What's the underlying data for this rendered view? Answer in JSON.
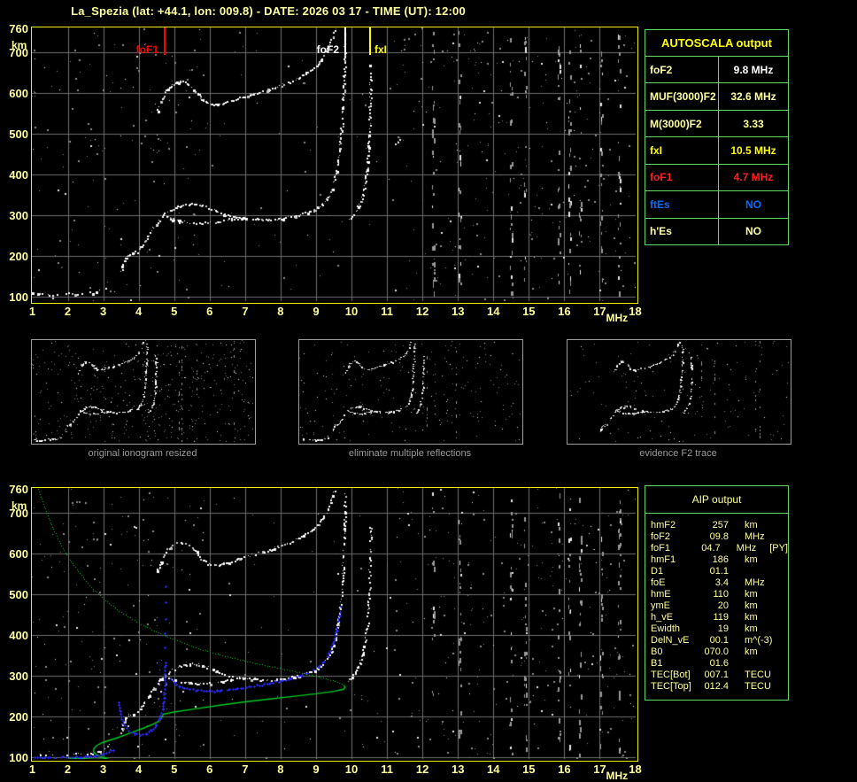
{
  "title": "La_Spezia (lat: +44.1, lon: 009.8) - DATE: 2026 03 17 - TIME (UT): 12:00",
  "colors": {
    "pale_yellow": "#ffff9b",
    "bright_yellow": "#ffff00",
    "white": "#ffffff",
    "red": "#ff1e1e",
    "blue": "#0a6bff",
    "trace_blue": "#2a2af0",
    "profile_green": "#00cc22",
    "table_green": "#62d862",
    "grid_gray": "#6f6f6f",
    "plot_border": "#eded10",
    "caption_gray": "#9a9a9a"
  },
  "autoscala_table": {
    "title": "AUTOSCALA output",
    "rows": [
      {
        "label": "foF2",
        "value": "9.8 MHz",
        "labelColor": "#ffff9b",
        "valueColor": "#ffffff"
      },
      {
        "label": "MUF(3000)F2",
        "value": "32.6 MHz",
        "labelColor": "#ffff9b",
        "valueColor": "#ffff9b"
      },
      {
        "label": "M(3000)F2",
        "value": "3.33",
        "labelColor": "#ffff9b",
        "valueColor": "#ffff9b"
      },
      {
        "label": "fxI",
        "value": "10.5 MHz",
        "labelColor": "#ffff00",
        "valueColor": "#ffff00"
      },
      {
        "label": "foF1",
        "value": "4.7 MHz",
        "labelColor": "#ff1e1e",
        "valueColor": "#ff1e1e"
      },
      {
        "label": "ftEs",
        "value": "NO",
        "labelColor": "#0a6bff",
        "valueColor": "#0a6bff"
      },
      {
        "label": "h'Es",
        "value": "NO",
        "labelColor": "#ffff9b",
        "valueColor": "#ffff9b"
      }
    ]
  },
  "aip_table": {
    "title": "AIP output",
    "rows": [
      {
        "label": "hmF2",
        "value": "257",
        "unit": "km",
        "extra": ""
      },
      {
        "label": "foF2",
        "value": "09.8",
        "unit": "MHz",
        "extra": ""
      },
      {
        "label": "foF1",
        "value": "04.7",
        "unit": "MHz",
        "extra": "[PY]"
      },
      {
        "label": "hmF1",
        "value": "186",
        "unit": "km",
        "extra": ""
      },
      {
        "label": "D1",
        "value": "01.1",
        "unit": "",
        "extra": ""
      },
      {
        "label": "foE",
        "value": "3.4",
        "unit": "MHz",
        "extra": ""
      },
      {
        "label": "hmE",
        "value": "110",
        "unit": "km",
        "extra": ""
      },
      {
        "label": "ymE",
        "value": "20",
        "unit": "km",
        "extra": ""
      },
      {
        "label": "h_vE",
        "value": "119",
        "unit": "km",
        "extra": ""
      },
      {
        "label": "Ewidth",
        "value": "19",
        "unit": "km",
        "extra": ""
      },
      {
        "label": "DelN_vE",
        "value": "00.1",
        "unit": "m^(-3)",
        "extra": ""
      },
      {
        "label": "B0",
        "value": "070.0",
        "unit": "km",
        "extra": ""
      },
      {
        "label": "B1",
        "value": "01.6",
        "unit": "",
        "extra": ""
      },
      {
        "label": "TEC[Bot]",
        "value": "007.1",
        "unit": "TECU",
        "extra": ""
      },
      {
        "label": "TEC[Top]",
        "value": "012.4",
        "unit": "TECU",
        "extra": ""
      }
    ]
  },
  "thumbnails": [
    {
      "caption": "original ionogram resized"
    },
    {
      "caption": "eliminate multiple reflections"
    },
    {
      "caption": "evidence F2 trace"
    }
  ],
  "chart_data": {
    "type": "ionogram",
    "x_axis": {
      "label": "MHz",
      "range": [
        1,
        18
      ],
      "ticks": [
        1,
        2,
        3,
        4,
        5,
        6,
        7,
        8,
        9,
        10,
        11,
        12,
        13,
        14,
        15,
        16,
        17,
        18
      ]
    },
    "y_axis": {
      "label": "km",
      "range": [
        100,
        760
      ],
      "ticks": [
        760,
        700,
        600,
        500,
        400,
        300,
        200,
        100
      ]
    },
    "grid": true,
    "markers": [
      {
        "label": "foF1",
        "freq": 4.7,
        "color": "#ff0000",
        "side": "left"
      },
      {
        "label": "foF2",
        "freq": 9.8,
        "color": "#ffffff",
        "side": "left"
      },
      {
        "label": "fxI",
        "freq": 10.5,
        "color": "#ffff00",
        "side": "right"
      }
    ],
    "traces": {
      "e": [
        [
          1.0,
          110
        ],
        [
          1.2,
          108
        ],
        [
          1.45,
          107
        ],
        [
          1.7,
          107
        ],
        [
          1.95,
          108
        ],
        [
          2.2,
          108
        ],
        [
          2.45,
          109
        ],
        [
          2.7,
          111
        ],
        [
          2.9,
          115
        ],
        [
          3.05,
          122
        ],
        [
          3.18,
          131
        ]
      ],
      "f1arm": [
        [
          3.5,
          163
        ],
        [
          3.55,
          182
        ],
        [
          3.6,
          196
        ],
        [
          3.7,
          204
        ],
        [
          3.82,
          207
        ],
        [
          3.95,
          212
        ],
        [
          4.1,
          228
        ],
        [
          4.25,
          249
        ],
        [
          4.4,
          270
        ],
        [
          4.55,
          288
        ],
        [
          4.65,
          298
        ],
        [
          4.72,
          306
        ]
      ],
      "f2low": [
        [
          4.78,
          299
        ],
        [
          4.95,
          291
        ],
        [
          5.15,
          286
        ],
        [
          5.4,
          283
        ],
        [
          5.7,
          281
        ],
        [
          6.0,
          283
        ],
        [
          6.3,
          287
        ],
        [
          6.6,
          292
        ],
        [
          6.9,
          296
        ]
      ],
      "f2bump": [
        [
          4.82,
          308
        ],
        [
          4.95,
          316
        ],
        [
          5.1,
          322
        ],
        [
          5.3,
          328
        ],
        [
          5.5,
          330
        ],
        [
          5.7,
          327
        ],
        [
          5.9,
          321
        ],
        [
          6.15,
          312
        ],
        [
          6.4,
          304
        ],
        [
          6.65,
          299
        ],
        [
          6.9,
          296
        ]
      ],
      "f2main": [
        [
          6.9,
          296
        ],
        [
          7.2,
          293
        ],
        [
          7.6,
          291
        ],
        [
          8.0,
          293
        ],
        [
          8.4,
          299
        ],
        [
          8.7,
          306
        ],
        [
          8.95,
          315
        ],
        [
          9.15,
          327
        ],
        [
          9.3,
          342
        ],
        [
          9.42,
          362
        ],
        [
          9.52,
          390
        ],
        [
          9.6,
          425
        ],
        [
          9.66,
          465
        ],
        [
          9.71,
          510
        ],
        [
          9.75,
          565
        ],
        [
          9.78,
          625
        ],
        [
          9.8,
          690
        ],
        [
          9.81,
          748
        ]
      ],
      "xriser": [
        [
          9.9,
          288
        ],
        [
          10.05,
          302
        ],
        [
          10.18,
          322
        ],
        [
          10.3,
          350
        ],
        [
          10.38,
          388
        ],
        [
          10.44,
          432
        ],
        [
          10.48,
          485
        ],
        [
          10.5,
          545
        ],
        [
          10.52,
          612
        ],
        [
          10.53,
          668
        ]
      ],
      "hump": [
        [
          4.52,
          556
        ],
        [
          4.62,
          582
        ],
        [
          4.74,
          604
        ],
        [
          4.88,
          618
        ],
        [
          5.02,
          627
        ],
        [
          5.18,
          630
        ],
        [
          5.34,
          625
        ],
        [
          5.5,
          614
        ],
        [
          5.64,
          600
        ],
        [
          5.78,
          586
        ],
        [
          5.95,
          576
        ],
        [
          6.12,
          573
        ],
        [
          6.35,
          576
        ],
        [
          6.6,
          582
        ],
        [
          6.9,
          590
        ],
        [
          7.25,
          599
        ],
        [
          7.6,
          608
        ],
        [
          7.95,
          618
        ],
        [
          8.3,
          630
        ],
        [
          8.6,
          643
        ],
        [
          8.85,
          658
        ],
        [
          9.05,
          673
        ],
        [
          9.2,
          690
        ],
        [
          9.32,
          710
        ],
        [
          9.42,
          733
        ],
        [
          9.5,
          756
        ]
      ]
    },
    "profile": {
      "color": "#00cc22",
      "dotted": [
        [
          1.15,
          758
        ],
        [
          1.3,
          722
        ],
        [
          1.45,
          688
        ],
        [
          1.62,
          655
        ],
        [
          1.82,
          620
        ],
        [
          2.05,
          586
        ],
        [
          2.33,
          552
        ],
        [
          2.66,
          518
        ],
        [
          3.05,
          486
        ],
        [
          3.5,
          456
        ],
        [
          4.0,
          430
        ],
        [
          4.55,
          406
        ],
        [
          5.15,
          384
        ],
        [
          5.8,
          364
        ],
        [
          6.5,
          347
        ],
        [
          7.2,
          333
        ],
        [
          7.9,
          320
        ],
        [
          8.6,
          307
        ],
        [
          9.2,
          295
        ],
        [
          9.6,
          285
        ],
        [
          9.78,
          277
        ]
      ],
      "solid": [
        [
          9.78,
          277
        ],
        [
          9.82,
          272
        ],
        [
          9.78,
          267
        ],
        [
          9.5,
          262
        ],
        [
          9.0,
          256
        ],
        [
          8.4,
          250
        ],
        [
          7.7,
          243
        ],
        [
          7.0,
          236
        ],
        [
          6.3,
          228
        ],
        [
          5.6,
          219
        ],
        [
          5.0,
          211
        ],
        [
          4.7,
          206
        ],
        [
          4.65,
          198
        ],
        [
          4.6,
          190
        ],
        [
          4.4,
          181
        ],
        [
          4.15,
          172
        ],
        [
          3.9,
          164
        ],
        [
          3.65,
          156
        ],
        [
          3.4,
          148
        ],
        [
          3.15,
          141
        ],
        [
          2.95,
          135
        ],
        [
          2.8,
          128
        ],
        [
          2.73,
          120
        ],
        [
          2.73,
          112
        ],
        [
          2.82,
          106
        ],
        [
          2.95,
          101
        ],
        [
          3.1,
          98
        ],
        [
          3.0,
          96
        ],
        [
          2.8,
          95
        ],
        [
          2.55,
          96
        ],
        [
          2.3,
          97
        ],
        [
          2.05,
          98
        ]
      ]
    },
    "restored": {
      "color": "#2a2af0",
      "e": [
        [
          1.05,
          100
        ],
        [
          1.35,
          100
        ],
        [
          1.65,
          100
        ],
        [
          1.95,
          101
        ],
        [
          2.25,
          101
        ],
        [
          2.55,
          102
        ],
        [
          2.8,
          104
        ],
        [
          3.0,
          107
        ],
        [
          3.15,
          112
        ],
        [
          3.28,
          119
        ]
      ],
      "f1": [
        [
          3.44,
          236
        ],
        [
          3.47,
          214
        ],
        [
          3.52,
          194
        ],
        [
          3.6,
          178
        ],
        [
          3.72,
          166
        ],
        [
          3.87,
          158
        ],
        [
          4.03,
          155
        ],
        [
          4.2,
          158
        ],
        [
          4.36,
          166
        ],
        [
          4.5,
          179
        ],
        [
          4.6,
          196
        ],
        [
          4.67,
          218
        ],
        [
          4.71,
          245
        ],
        [
          4.73,
          275
        ],
        [
          4.74,
          305
        ],
        [
          4.75,
          335
        ]
      ],
      "f1_dots": [
        [
          4.73,
          370
        ],
        [
          4.74,
          405
        ],
        [
          4.75,
          440
        ],
        [
          4.76,
          480
        ],
        [
          4.76,
          520
        ]
      ],
      "f2": [
        [
          4.9,
          295
        ],
        [
          5.0,
          284
        ],
        [
          5.15,
          275
        ],
        [
          5.35,
          269
        ],
        [
          5.6,
          265
        ],
        [
          5.9,
          263
        ],
        [
          6.2,
          264
        ],
        [
          6.5,
          266
        ],
        [
          6.8,
          269
        ],
        [
          7.1,
          273
        ],
        [
          7.4,
          277
        ],
        [
          7.7,
          282
        ],
        [
          8.0,
          288
        ],
        [
          8.3,
          294
        ],
        [
          8.6,
          302
        ],
        [
          8.85,
          311
        ],
        [
          9.05,
          322
        ],
        [
          9.22,
          336
        ],
        [
          9.36,
          355
        ],
        [
          9.48,
          380
        ],
        [
          9.58,
          412
        ],
        [
          9.66,
          448
        ],
        [
          9.7,
          470
        ]
      ]
    },
    "rfi_freqs": [
      12.3,
      13.05,
      14.5,
      14.9,
      15.85,
      16.15,
      16.45,
      17.05,
      17.55
    ],
    "thumbs": [
      {
        "traces": [
          "e",
          "f1arm",
          "f2low",
          "f2bump",
          "f2main",
          "xriser",
          "hump"
        ],
        "noise": 420,
        "columns": 5
      },
      {
        "traces": [
          "e",
          "f1arm",
          "f2low",
          "f2bump",
          "f2main",
          "xriser",
          "hump"
        ],
        "noise": 210,
        "columns": 2
      },
      {
        "traces": [
          "f1arm",
          "f2low",
          "f2bump",
          "f2main",
          "xriser",
          "hump"
        ],
        "noise": 140,
        "columns": 4
      }
    ]
  }
}
